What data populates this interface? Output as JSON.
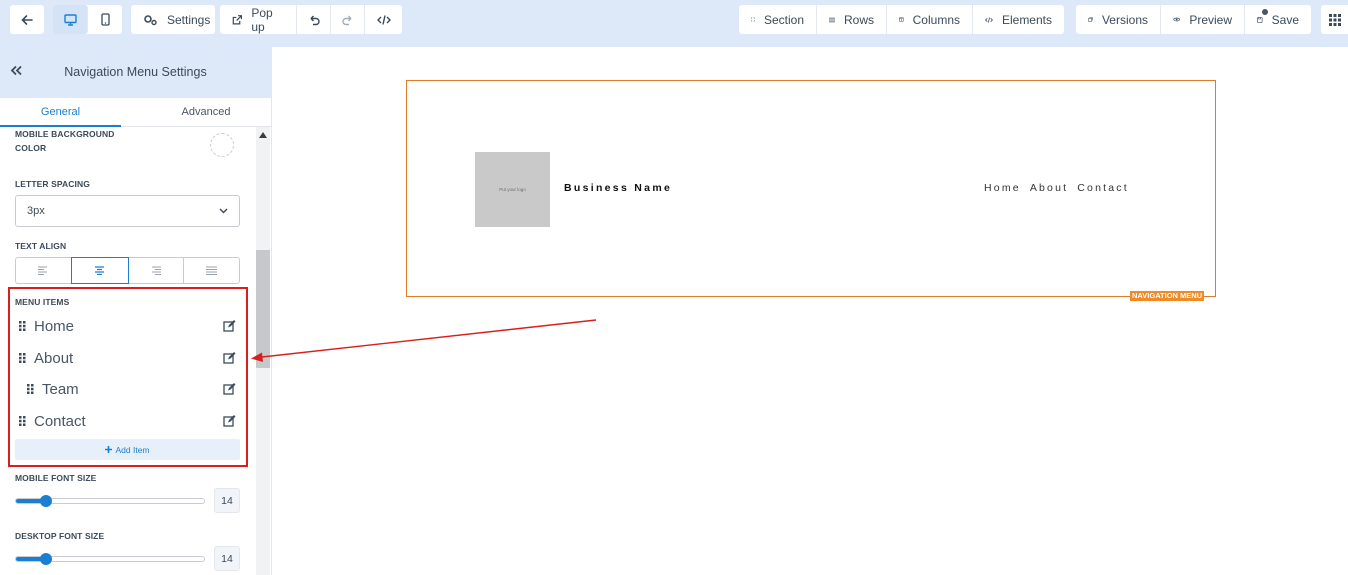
{
  "toolbar": {
    "settings_label": "Settings",
    "popup_label": "Pop up",
    "section_label": "Section",
    "rows_label": "Rows",
    "columns_label": "Columns",
    "elements_label": "Elements",
    "versions_label": "Versions",
    "preview_label": "Preview",
    "save_label": "Save"
  },
  "panel": {
    "title": "Navigation Menu Settings",
    "tabs": {
      "general": "General",
      "advanced": "Advanced"
    },
    "mobile_bg_label_1": "MOBILE BACKGROUND",
    "mobile_bg_label_2": "COLOR",
    "letter_spacing_label": "LETTER SPACING",
    "letter_spacing_value": "3px",
    "text_align_label": "TEXT ALIGN",
    "text_align_selected": "center",
    "menu_items_label": "MENU ITEMS",
    "menu_items": [
      {
        "label": "Home",
        "indent": 0
      },
      {
        "label": "About",
        "indent": 0
      },
      {
        "label": "Team",
        "indent": 1
      },
      {
        "label": "Contact",
        "indent": 0
      }
    ],
    "add_item_label": "Add Item",
    "mobile_font_size_label": "MOBILE FONT SIZE",
    "mobile_font_size": "14",
    "desktop_font_size_label": "DESKTOP FONT SIZE",
    "desktop_font_size": "14"
  },
  "canvas": {
    "logo_placeholder": "Put your logo",
    "business_name": "Business Name",
    "nav_links": [
      "Home",
      "About",
      "Contact"
    ],
    "element_tag": "NAVIGATION MENU"
  },
  "colors": {
    "accent": "#1a7fd3",
    "toolbar_bg": "#dde9f8",
    "highlight_box": "#d81e1e",
    "element_border": "#e07b2a"
  }
}
